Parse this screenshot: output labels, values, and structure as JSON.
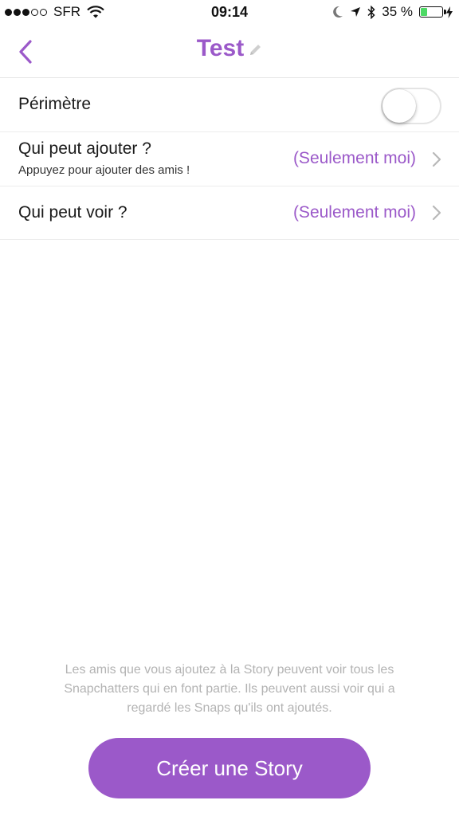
{
  "status_bar": {
    "carrier": "SFR",
    "signal_dots_filled": 3,
    "signal_dots_total": 5,
    "time": "09:14",
    "battery_percent": "35 %",
    "battery_level": 0.35,
    "icons": [
      "wifi-icon",
      "moon-icon",
      "location-arrow-icon",
      "bluetooth-icon",
      "battery-icon",
      "charging-bolt-icon"
    ]
  },
  "header": {
    "title": "Test",
    "back_icon": "chevron-left-icon",
    "edit_icon": "pencil-icon"
  },
  "settings": {
    "perimeter": {
      "label": "Périmètre",
      "enabled": false
    },
    "who_can_add": {
      "label": "Qui peut ajouter ?",
      "sublabel": "Appuyez pour ajouter des amis !",
      "value": "(Seulement moi)"
    },
    "who_can_view": {
      "label": "Qui peut voir ?",
      "value": "(Seulement moi)"
    }
  },
  "footer": {
    "note": "Les amis que vous ajoutez à la Story peuvent voir tous les Snapchatters qui en font partie. Ils peuvent aussi voir qui a regardé les Snaps qu'ils ont ajoutés.",
    "create_button": "Créer une Story"
  },
  "colors": {
    "accent": "#9b59c9",
    "battery_fill": "#4cd964",
    "note_text": "#b3b3b3"
  }
}
